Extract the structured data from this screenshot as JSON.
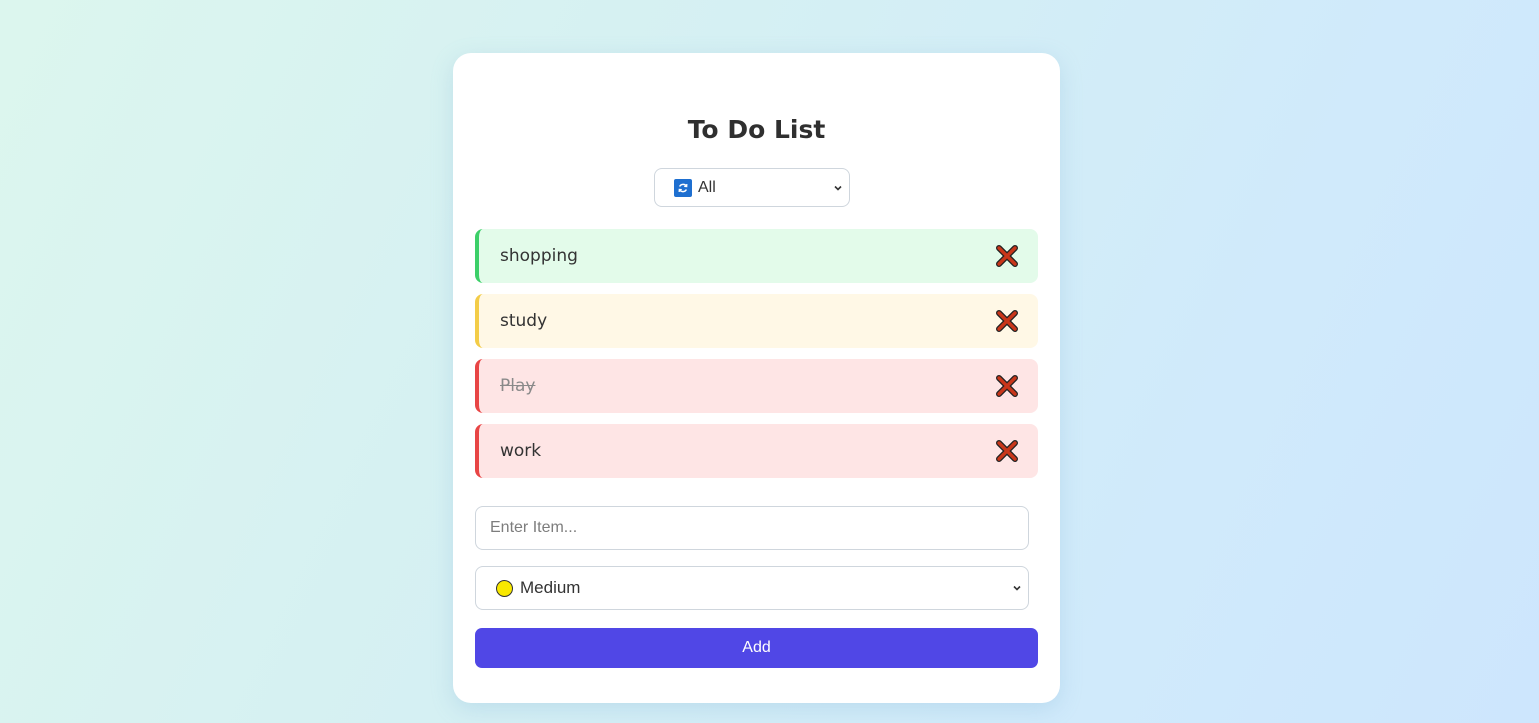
{
  "app": {
    "title": "To Do List"
  },
  "filter": {
    "selected_label": "All",
    "icon": "refresh-icon"
  },
  "items": [
    {
      "text": "shopping",
      "priority": "low",
      "completed": false
    },
    {
      "text": "study",
      "priority": "medium",
      "completed": false
    },
    {
      "text": "Play",
      "priority": "high",
      "completed": true
    },
    {
      "text": "work",
      "priority": "high",
      "completed": false
    }
  ],
  "new_item": {
    "value": "",
    "placeholder": "Enter Item..."
  },
  "priority_select": {
    "selected_label": "Medium",
    "icon": "yellow-circle-icon"
  },
  "add_button": {
    "label": "Add"
  },
  "colors": {
    "accent": "#5047e6",
    "low_bg": "#e3fbea",
    "low_border": "#3ccf68",
    "medium_bg": "#fff8e6",
    "medium_border": "#f3cc47",
    "high_bg": "#fee5e5",
    "high_border": "#e84545"
  }
}
